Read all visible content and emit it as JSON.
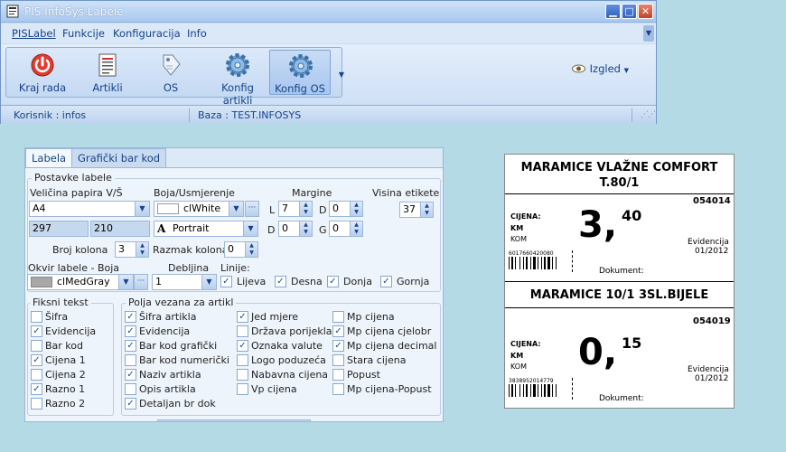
{
  "window": {
    "title": "PIS InfoSys Labele",
    "min_glyph": "▁",
    "max_glyph": "□",
    "close_glyph": "✕"
  },
  "menu": {
    "items": [
      "PISLabel",
      "Funkcije",
      "Konfiguracija",
      "Info"
    ]
  },
  "ribbon": {
    "buttons": [
      {
        "label": "Kraj rada",
        "icon": "power-icon"
      },
      {
        "label": "Artikli",
        "icon": "document-list-icon"
      },
      {
        "label": "OS",
        "icon": "tag-icon"
      },
      {
        "label": "Konfig artikli",
        "icon": "gear-icon"
      },
      {
        "label": "Konfig OS",
        "icon": "gear-icon"
      }
    ],
    "izgled_label": "Izgled",
    "izgled_icon": "eye-icon"
  },
  "status": {
    "user": "Korisnik :  infos",
    "db": "Baza :  TEST.INFOSYS"
  },
  "tabs": [
    "Labela",
    "Grafički bar kod"
  ],
  "postavke": {
    "group_label": "Postavke labele",
    "paper_size_label": "Veličina papira V/Š",
    "paper_size_value": "A4",
    "paper_h": "297",
    "paper_w": "210",
    "color_label": "Boja/Usmjerenje",
    "color_value": "clWhite",
    "orientation_value": "Portrait",
    "margins_label": "Margine",
    "margin_l_label": "L",
    "margin_l": "7",
    "margin_d_label": "D",
    "margin_d": "0",
    "margin_d2_label": "D",
    "margin_d2": "0",
    "margin_g_label": "G",
    "margin_g": "0",
    "height_label": "Visina etikete",
    "height_value": "37",
    "cols_label": "Broj kolona",
    "cols_value": "3",
    "colspace_label": "Razmak kolona",
    "colspace_value": "0",
    "frame_label": "Okvir labele  -  Boja",
    "frame_color": "clMedGray",
    "thickness_label": "Debljina",
    "thickness_value": "1",
    "lines_label": "Linije:",
    "lines": [
      {
        "label": "Lijeva",
        "checked": true
      },
      {
        "label": "Desna",
        "checked": true
      },
      {
        "label": "Donja",
        "checked": true
      },
      {
        "label": "Gornja",
        "checked": true
      }
    ]
  },
  "fiksni": {
    "group_label": "Fiksni tekst",
    "items": [
      {
        "label": "Šifra",
        "checked": false
      },
      {
        "label": "Evidencija",
        "checked": true
      },
      {
        "label": "Bar kod",
        "checked": false
      },
      {
        "label": "Cijena 1",
        "checked": true
      },
      {
        "label": "Cijena 2",
        "checked": false
      },
      {
        "label": "Razno 1",
        "checked": true
      },
      {
        "label": "Razno 2",
        "checked": false
      }
    ]
  },
  "polja": {
    "group_label": "Polja vezana za artikl",
    "col1": [
      {
        "label": "Šifra artikla",
        "checked": true
      },
      {
        "label": "Evidencija",
        "checked": true
      },
      {
        "label": "Bar kod grafički",
        "checked": true
      },
      {
        "label": "Bar kod numerički",
        "checked": false
      },
      {
        "label": "Naziv artikla",
        "checked": true
      },
      {
        "label": "Opis artikla",
        "checked": false
      },
      {
        "label": "Detaljan br dok",
        "checked": true
      }
    ],
    "col2": [
      {
        "label": "Jed mjere",
        "checked": true
      },
      {
        "label": "Država porijekla",
        "checked": false
      },
      {
        "label": "Oznaka valute",
        "checked": true
      },
      {
        "label": "Logo poduzeća",
        "checked": false
      },
      {
        "label": "Nabavna cijena",
        "checked": false
      },
      {
        "label": "Vp cijena",
        "checked": false
      }
    ],
    "col3": [
      {
        "label": "Mp cijena",
        "checked": false
      },
      {
        "label": "Mp cijena cjelobr",
        "checked": true
      },
      {
        "label": "Mp cijena decimal",
        "checked": true
      },
      {
        "label": "Stara cijena",
        "checked": false
      },
      {
        "label": "Popust",
        "checked": false
      },
      {
        "label": "Mp cijena-Popust",
        "checked": false
      }
    ]
  },
  "labels": [
    {
      "title_1": "MARAMICE VLAŽNE COMFORT",
      "title_2": "T.80/1",
      "code": "054014",
      "cijena_label": "CIJENA:",
      "currency": "KM",
      "unit": "KOM",
      "price_int": "3,",
      "price_dec": "40",
      "barcode_num": "6017660420080",
      "evidencija_label": "Evidencija",
      "evidencija_value": "01/2012",
      "dokument_label": "Dokument:"
    },
    {
      "title_1": "MARAMICE 10/1 3SL.BIJELE",
      "title_2": "",
      "code": "054019",
      "cijena_label": "CIJENA:",
      "currency": "KM",
      "unit": "KOM",
      "price_int": "0,",
      "price_dec": "15",
      "barcode_num": "3838952014779",
      "evidencija_label": "Evidencija",
      "evidencija_value": "01/2012",
      "dokument_label": "Dokument:"
    }
  ],
  "colors": {
    "accent": "#15428b",
    "window_border": "#6f95c9",
    "background": "#b3dae5"
  }
}
